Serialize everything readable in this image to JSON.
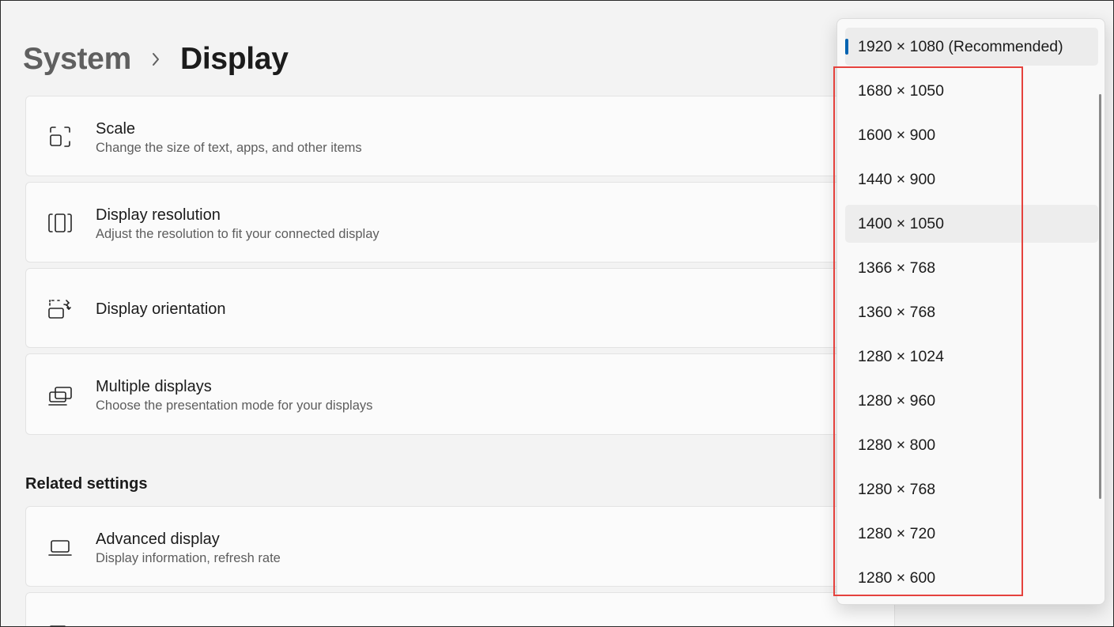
{
  "breadcrumb": {
    "parent": "System",
    "separator_icon": "chevron-right-icon",
    "current": "Display"
  },
  "cards": {
    "scale": {
      "icon": "scale-icon",
      "title": "Scale",
      "subtitle": "Change the size of text, apps, and other items"
    },
    "resolution": {
      "icon": "resolution-icon",
      "title": "Display resolution",
      "subtitle": "Adjust the resolution to fit your connected display"
    },
    "orientation": {
      "icon": "orientation-icon",
      "title": "Display orientation"
    },
    "multiple": {
      "icon": "multiple-displays-icon",
      "title": "Multiple displays",
      "subtitle": "Choose the presentation mode for your displays"
    },
    "advanced": {
      "icon": "laptop-icon",
      "title": "Advanced display",
      "subtitle": "Display information, refresh rate"
    },
    "next_partial": {
      "icon": "brush-icon"
    }
  },
  "related_settings": {
    "title": "Related settings"
  },
  "resolution_dropdown": {
    "selected": "1920 × 1080 (Recommended)",
    "options": [
      "1920 × 1080 (Recommended)",
      "1680 × 1050",
      "1600 × 900",
      "1440 × 900",
      "1400 × 1050",
      "1366 × 768",
      "1360 × 768",
      "1280 × 1024",
      "1280 × 960",
      "1280 × 800",
      "1280 × 768",
      "1280 × 720",
      "1280 × 600"
    ],
    "hovered": "1400 × 1050",
    "accent_color": "#0063b1"
  },
  "annotation": {
    "highlight_color": "#e5423d"
  }
}
